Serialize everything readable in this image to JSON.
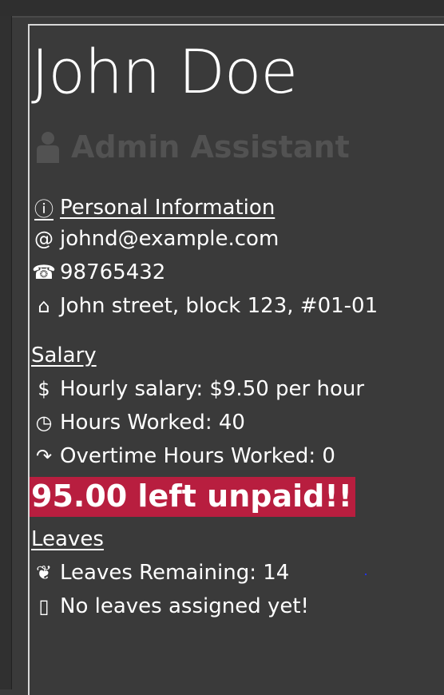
{
  "profile": {
    "name": "John Doe",
    "role": "Admin Assistant"
  },
  "personal": {
    "heading": "Personal Information",
    "email": "johnd@example.com",
    "phone": "98765432",
    "address": "John street, block 123, #01-01"
  },
  "salary": {
    "heading": "Salary",
    "hourly": "Hourly salary: $9.50 per hour",
    "hours": "Hours Worked: 40",
    "overtime": "Overtime Hours Worked: 0",
    "unpaid": "95.00 left unpaid!!"
  },
  "leaves": {
    "heading": "Leaves",
    "remaining": "Leaves Remaining: 14",
    "assigned": "No leaves assigned yet!"
  },
  "icons": {
    "info": "ⓘ",
    "email": "@",
    "phone": "☎",
    "home": "⌂",
    "dollar": "$",
    "clock": "◷",
    "overtime": "↷",
    "leaf": "❦",
    "calendar": "▯"
  },
  "colors": {
    "background": "#3a3a3a",
    "unpaid_bg": "#b81e3f",
    "role_text": "#525252"
  }
}
